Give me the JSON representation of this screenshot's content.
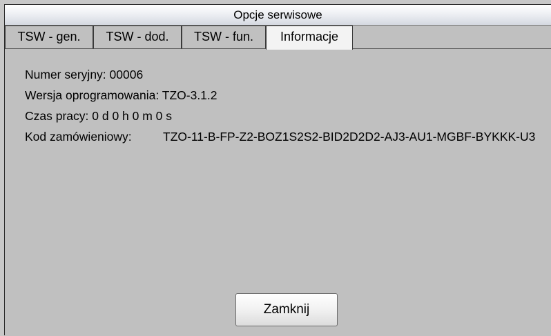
{
  "window": {
    "title": "Opcje serwisowe"
  },
  "tabs": [
    {
      "label": "TSW - gen."
    },
    {
      "label": "TSW - dod."
    },
    {
      "label": "TSW - fun."
    },
    {
      "label": "Informacje"
    }
  ],
  "active_tab": "Informacje",
  "info": {
    "serial_label": "Numer seryjny:",
    "serial_value": "00006",
    "software_label": "Wersja oprogramowania:",
    "software_value": "TZO-3.1.2",
    "runtime_label": "Czas pracy:",
    "runtime_value": "0 d 0 h 0 m 0 s",
    "order_code_label": "Kod zamówieniowy:",
    "order_code_value": "TZO-11-B-FP-Z2-BOZ1S2S2-BID2D2D2-AJ3-AU1-MGBF-BYKKK-U3"
  },
  "footer": {
    "close_label": "Zamknij"
  }
}
